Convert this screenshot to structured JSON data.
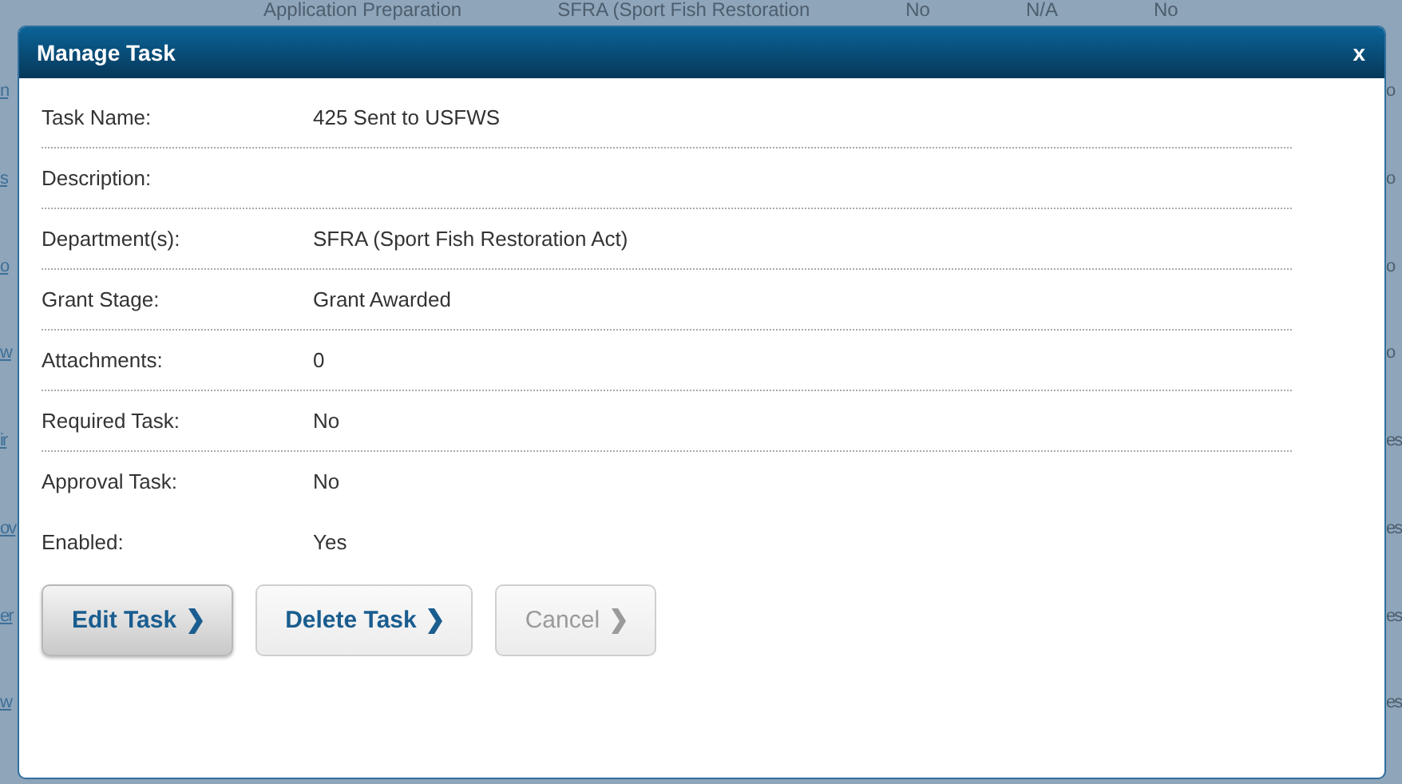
{
  "backdrop": {
    "top_row": [
      "Application Preparation",
      "SFRA (Sport Fish Restoration",
      "No",
      "N/A",
      "No"
    ],
    "rows": [
      {
        "left": "n",
        "right": "o"
      },
      {
        "left": "s",
        "right": "o"
      },
      {
        "left": "o",
        "right": "o"
      },
      {
        "left": "w",
        "right": "o"
      },
      {
        "left": "ir",
        "right": "es"
      },
      {
        "left": "ov",
        "right": "es"
      },
      {
        "left": "er",
        "right": "es"
      },
      {
        "left": "w",
        "right": "es"
      }
    ]
  },
  "dialog": {
    "title": "Manage Task",
    "close": "x",
    "fields": [
      {
        "label": "Task Name:",
        "value": "425 Sent to USFWS",
        "ruled": true
      },
      {
        "label": "Description:",
        "ruled": true
      },
      {
        "label": "Department(s):",
        "value": "SFRA (Sport Fish Restoration Act)",
        "ruled": true
      },
      {
        "label": "Grant Stage:",
        "value": "Grant Awarded",
        "ruled": true
      },
      {
        "label": "Attachments:",
        "value": "0",
        "ruled": true
      },
      {
        "label": "Required Task:",
        "value": "No",
        "ruled": true
      },
      {
        "label": "Approval Task:",
        "value": "No",
        "ruled": false
      },
      {
        "label": "Enabled:",
        "value": "Yes",
        "ruled": false
      }
    ],
    "buttons": [
      {
        "label": "Edit Task",
        "focused": true,
        "disabled": false
      },
      {
        "label": "Delete Task",
        "focused": false,
        "disabled": false
      },
      {
        "label": "Cancel",
        "focused": false,
        "disabled": true
      }
    ]
  }
}
